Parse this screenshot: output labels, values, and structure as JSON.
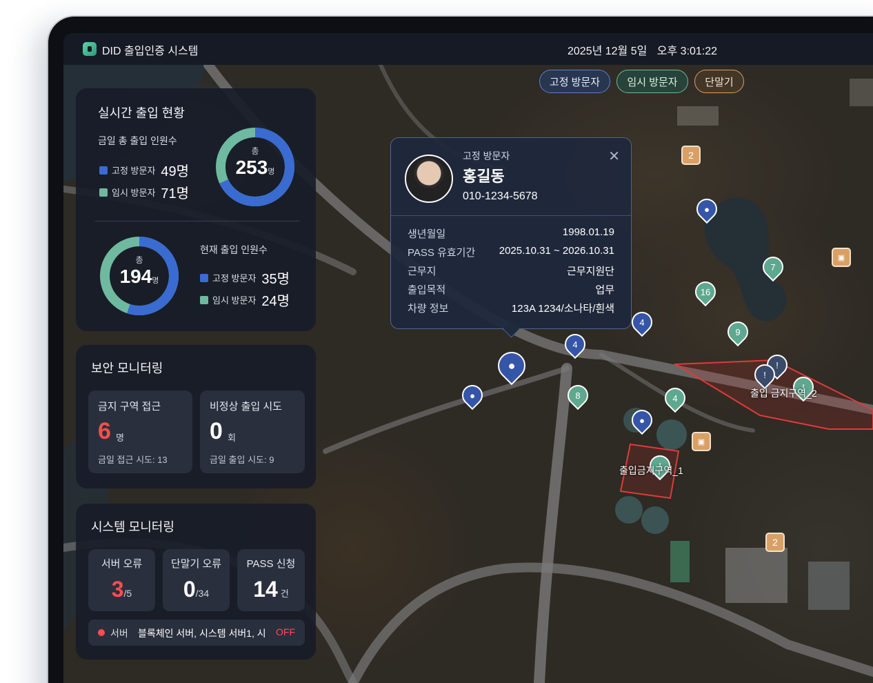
{
  "header": {
    "app_title": "DID 출입인증 시스템",
    "date": "2025년 12월 5일",
    "time": "오후 3:01:22"
  },
  "filters": {
    "fixed": "고정 방문자",
    "temp": "임시 방문자",
    "terminal": "단말기"
  },
  "realtime": {
    "title": "실시간 출입 현황",
    "today_total_label": "금일 총 출입 인원수",
    "today": {
      "fixed_label": "고정 방문자",
      "fixed_value": "49명",
      "temp_label": "임시 방문자",
      "temp_value": "71명",
      "total_prefix": "총",
      "total": "253",
      "total_unit": "명",
      "fixed_fraction": 0.68
    },
    "current_label": "현재 출입 인원수",
    "current": {
      "fixed_label": "고정 방문자",
      "fixed_value": "35명",
      "temp_label": "임시 방문자",
      "temp_value": "24명",
      "total_prefix": "총",
      "total": "194",
      "total_unit": "명",
      "fixed_fraction": 0.55
    }
  },
  "security": {
    "title": "보안 모니터링",
    "restricted": {
      "label": "금지 구역 접근",
      "value": "6",
      "unit": "명",
      "sub": "금일 접근 시도: 13"
    },
    "abnormal": {
      "label": "비정상 출입 시도",
      "value": "0",
      "unit": "회",
      "sub": "금일 출입 시도: 9"
    }
  },
  "system": {
    "title": "시스템 모니터링",
    "server_error": {
      "label": "서버 오류",
      "value": "3",
      "total": "/5"
    },
    "terminal_error": {
      "label": "단말기 오류",
      "value": "0",
      "total": "/34"
    },
    "pass_request": {
      "label": "PASS 신청",
      "value": "14",
      "unit": "건"
    },
    "status": {
      "prefix": "서버",
      "servers": "블록체인 서버, 시스템 서버1, 시",
      "state": "OFF"
    }
  },
  "popup": {
    "type": "고정 방문자",
    "name": "홍길동",
    "phone": "010-1234-5678",
    "rows": [
      {
        "k": "생년월일",
        "v": "1998.01.19"
      },
      {
        "k": "PASS 유효기간",
        "v": "2025.10.31 ~ 2026.10.31"
      },
      {
        "k": "근무지",
        "v": "근무지원단"
      },
      {
        "k": "출입목적",
        "v": "업무"
      },
      {
        "k": "차량 정보",
        "v": "123A 1234/소나타/흰색"
      }
    ]
  },
  "map": {
    "zone1": "출입금지구역_1",
    "zone2": "출입 금지구역_2",
    "badges": [
      "2",
      "2"
    ],
    "blue_counts": [
      "4",
      "4"
    ],
    "green_counts": [
      "7",
      "16",
      "9",
      "8",
      "4",
      "4"
    ]
  },
  "colors": {
    "fixed": "#3a6bd1",
    "temp": "#6fb9a0",
    "alert": "#ff4d4d",
    "terminal": "#d9a066"
  }
}
